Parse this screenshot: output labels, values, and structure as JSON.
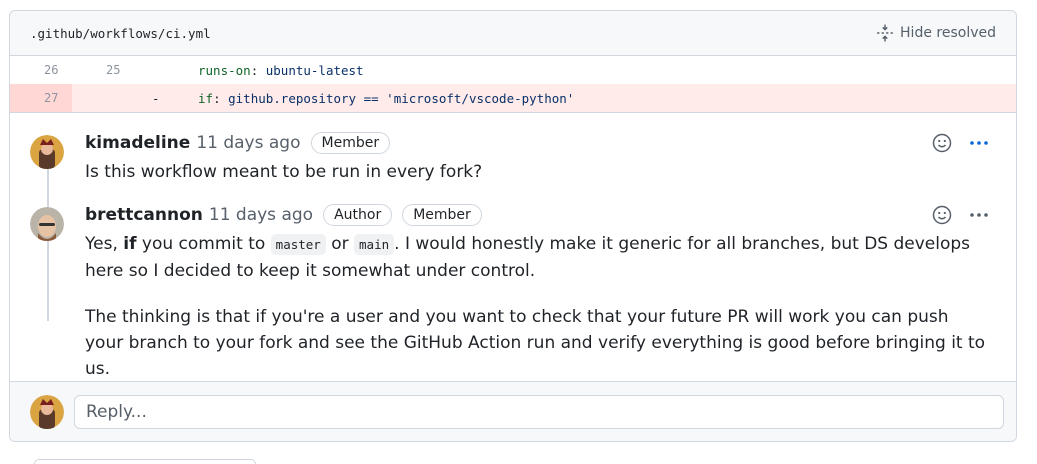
{
  "file": {
    "path": ".github/workflows/ci.yml",
    "hide_resolved_label": "Hide resolved"
  },
  "diff": {
    "rows": [
      {
        "old": "26",
        "new": "25",
        "marker": "",
        "key": "runs-on",
        "value": "ubuntu-latest"
      },
      {
        "old": "27",
        "new": "",
        "marker": "-",
        "key": "if",
        "value": "github.repository == 'microsoft/vscode-python'"
      }
    ]
  },
  "comments": [
    {
      "author": "kimadeline",
      "time": "11 days ago",
      "badges": [
        "Member"
      ],
      "body": "Is this workflow meant to be run in every fork?"
    },
    {
      "author": "brettcannon",
      "time": "11 days ago",
      "badges": [
        "Author",
        "Member"
      ],
      "p1_a": "Yes, ",
      "p1_bold": "if",
      "p1_b": " you commit to ",
      "p1_code1": "master",
      "p1_c": " or ",
      "p1_code2": "main",
      "p1_d": ". I would honestly make it generic for all branches, but DS develops here so I decided to keep it somewhat under control.",
      "p2": "The thinking is that if you're a user and you want to check that your future PR will work you can push your branch to your fork and see the GitHub Action run and verify everything is good before bringing it to us."
    }
  ],
  "reply": {
    "placeholder": "Reply..."
  },
  "colors": {
    "deleted_bg": "#ffebe9",
    "deleted_gutter": "#ffd7d5",
    "accent": "#0969da"
  }
}
